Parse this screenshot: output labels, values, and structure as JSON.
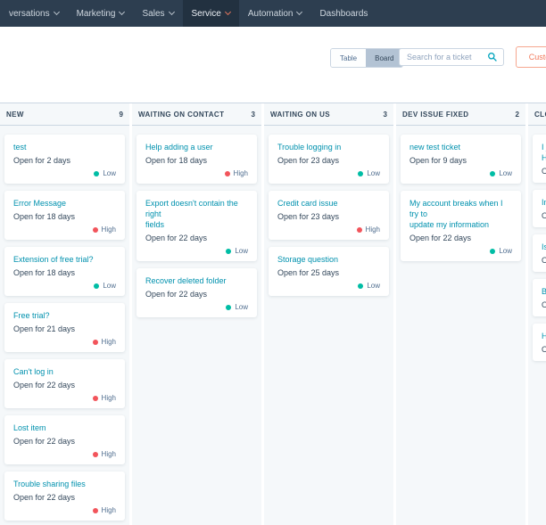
{
  "colors": {
    "low": "#00bda5",
    "high": "#f2545b",
    "accent": "#0091ae",
    "nav_bg": "#2d3e50",
    "orange": "#f2795b"
  },
  "navbar": {
    "items": [
      {
        "label": "versations",
        "caret": true,
        "active": false
      },
      {
        "label": "Marketing",
        "caret": true,
        "active": false
      },
      {
        "label": "Sales",
        "caret": true,
        "active": false
      },
      {
        "label": "Service",
        "caret": true,
        "active": true
      },
      {
        "label": "Automation",
        "caret": true,
        "active": false
      },
      {
        "label": "Dashboards",
        "caret": false,
        "active": false
      }
    ],
    "icons": [
      "search-icon",
      "settings-gear-icon",
      "notifications-bell-icon"
    ]
  },
  "toolbar": {
    "view_toggle": {
      "table": "Table",
      "board": "Board",
      "selected": "Board"
    },
    "search_placeholder": "Search for a ticket",
    "customize_label": "Customize"
  },
  "board": {
    "columns": [
      {
        "name": "NEW",
        "count": "9",
        "cards": [
          {
            "title": "test",
            "open_for": "Open for 2 days",
            "priority": "Low"
          },
          {
            "title": "Error Message",
            "open_for": "Open for 18 days",
            "priority": "High"
          },
          {
            "title": "Extension of free trial?",
            "open_for": "Open for 18 days",
            "priority": "Low"
          },
          {
            "title": "Free trial?",
            "open_for": "Open for 21 days",
            "priority": "High"
          },
          {
            "title": "Can't log in",
            "open_for": "Open for 22 days",
            "priority": "High"
          },
          {
            "title": "Lost item",
            "open_for": "Open for 22 days",
            "priority": "High"
          },
          {
            "title": "Trouble sharing files",
            "open_for": "Open for 22 days",
            "priority": "High"
          }
        ]
      },
      {
        "name": "WAITING ON CONTACT",
        "count": "3",
        "cards": [
          {
            "title": "Help adding a user",
            "open_for": "Open for 18 days",
            "priority": "High"
          },
          {
            "title": [
              "Export doesn't contain the right",
              "fields"
            ],
            "open_for": "Open for 22 days",
            "priority": "Low"
          },
          {
            "title": "Recover deleted folder",
            "open_for": "Open for 22 days",
            "priority": "Low"
          }
        ]
      },
      {
        "name": "WAITING ON US",
        "count": "3",
        "cards": [
          {
            "title": "Trouble logging in",
            "open_for": "Open for 23 days",
            "priority": "Low"
          },
          {
            "title": "Credit card issue",
            "open_for": "Open for 23 days",
            "priority": "High"
          },
          {
            "title": "Storage question",
            "open_for": "Open for 25 days",
            "priority": "Low"
          }
        ]
      },
      {
        "name": "DEV ISSUE FIXED",
        "count": "2",
        "cards": [
          {
            "title": "new test ticket",
            "open_for": "Open for 9 days",
            "priority": "Low"
          },
          {
            "title": [
              "My account breaks when I try to",
              "update my information"
            ],
            "open_for": "Open for 22 days",
            "priority": "Low"
          }
        ]
      },
      {
        "name": "CLOSED",
        "count": "",
        "cards": [
          {
            "title": [
              "I j",
              "H"
            ],
            "open_for": "O",
            "priority": null
          },
          {
            "title": "In",
            "open_for": "O",
            "priority": null
          },
          {
            "title": "Is",
            "open_for": "O",
            "priority": null
          },
          {
            "title": "Bi",
            "open_for": "O",
            "priority": null
          },
          {
            "title": "H",
            "open_for": "O",
            "priority": null
          }
        ]
      }
    ]
  }
}
